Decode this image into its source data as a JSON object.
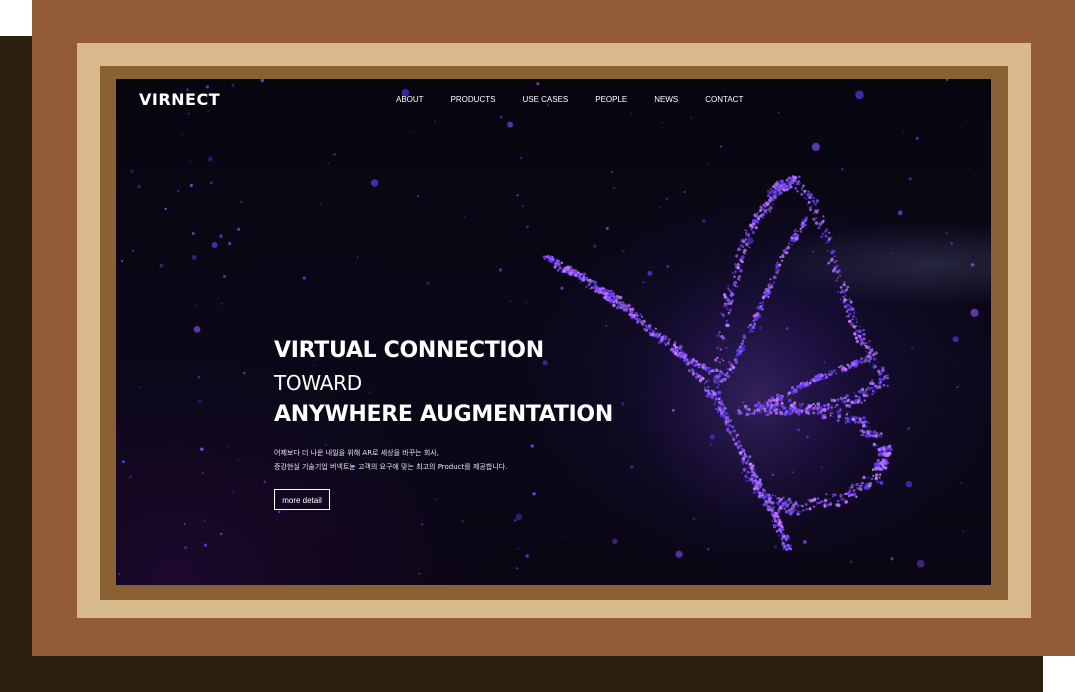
{
  "nav": {
    "logo": "VIRNECT",
    "items": [
      {
        "label": "ABOUT"
      },
      {
        "label": "PRODUCTS"
      },
      {
        "label": "USE CASES"
      },
      {
        "label": "PEOPLE"
      },
      {
        "label": "NEWS"
      },
      {
        "label": "CONTACT"
      }
    ]
  },
  "hero": {
    "line1": "VIRTUAL CONNECTION",
    "line2": "TOWARD",
    "line3": "ANYWHERE AUGMENTATION",
    "desc1": "어제보다 더 나은 내일을 위해 AR로 세상을 바꾸는 회사,",
    "desc2": "증강현실 기술기업 버넥트는 고객의 요구에 맞는 최고의 Product를 제공합니다.",
    "button": "more detail"
  },
  "colors": {
    "frame_outer": "#935b36",
    "frame_mat": "#d8b98b",
    "frame_inner": "#8a6035",
    "shadow": "#2c2012",
    "screen_bg": "#0a0818",
    "particle_accent": "#6a3cff"
  },
  "icons": {
    "hero_visual": "butterfly-particles-icon"
  }
}
